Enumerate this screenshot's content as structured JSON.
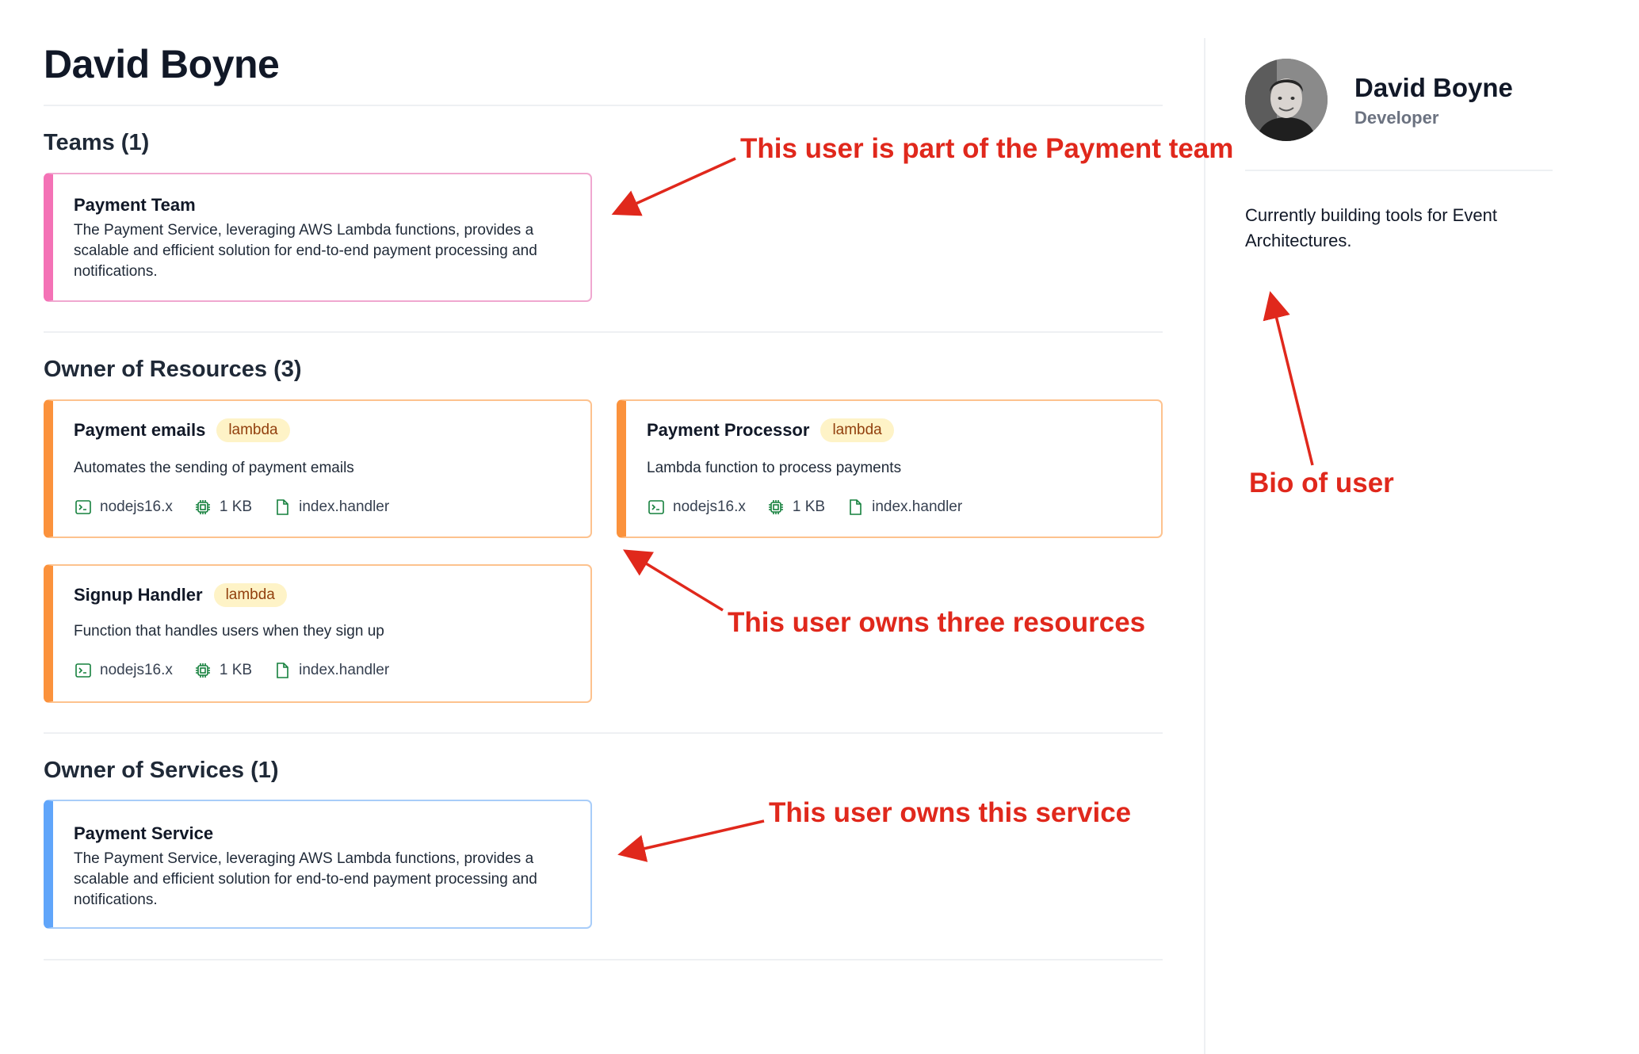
{
  "page": {
    "title": "David Boyne"
  },
  "teams": {
    "heading": "Teams (1)",
    "items": [
      {
        "title": "Payment Team",
        "description": "The Payment Service, leveraging AWS Lambda functions, provides a scalable and efficient solution for end-to-end payment processing and notifications."
      }
    ]
  },
  "resources": {
    "heading": "Owner of Resources (3)",
    "items": [
      {
        "title": "Payment emails",
        "badge": "lambda",
        "description": "Automates the sending of payment emails",
        "runtime": "nodejs16.x",
        "memory": "1 KB",
        "handler": "index.handler"
      },
      {
        "title": "Payment Processor",
        "badge": "lambda",
        "description": "Lambda function to process payments",
        "runtime": "nodejs16.x",
        "memory": "1 KB",
        "handler": "index.handler"
      },
      {
        "title": "Signup Handler",
        "badge": "lambda",
        "description": "Function that handles users when they sign up",
        "runtime": "nodejs16.x",
        "memory": "1 KB",
        "handler": "index.handler"
      }
    ]
  },
  "services": {
    "heading": "Owner of Services (1)",
    "items": [
      {
        "title": "Payment Service",
        "description": "The Payment Service, leveraging AWS Lambda functions, provides a scalable and efficient solution for end-to-end payment processing and notifications."
      }
    ]
  },
  "profile": {
    "name": "David Boyne",
    "role": "Developer",
    "bio": "Currently building tools for Event Architectures."
  },
  "annotations": {
    "team": "This user is part of the Payment team",
    "resources": "This user owns three resources",
    "service": "This user owns this service",
    "bio": "Bio of user"
  },
  "colors": {
    "team_accent": "#f472b6",
    "resource_accent": "#fb923c",
    "service_accent": "#60a5fa",
    "annotation": "#e0281c",
    "badge_bg": "#fef3c7"
  },
  "icons": {
    "runtime": "terminal-icon",
    "memory": "cpu-chip-icon",
    "handler": "document-icon"
  }
}
